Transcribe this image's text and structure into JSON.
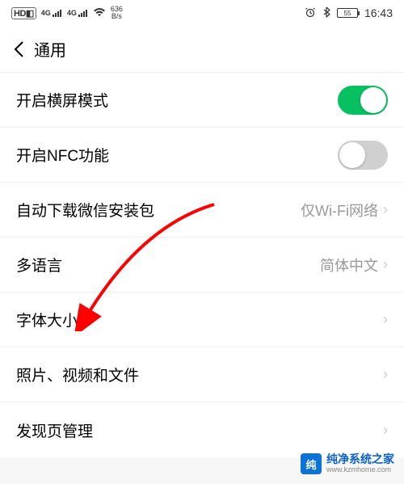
{
  "statusBar": {
    "hd": "HD",
    "sim1_net": "4G",
    "sim2_net": "4G",
    "netSpeed_top": "636",
    "netSpeed_bottom": "B/s",
    "battery": "55",
    "time": "16:43"
  },
  "nav": {
    "title": "通用"
  },
  "rows": {
    "landscape": {
      "label": "开启横屏模式"
    },
    "nfc": {
      "label": "开启NFC功能"
    },
    "autoDownload": {
      "label": "自动下载微信安装包",
      "value": "仅Wi-Fi网络"
    },
    "multiLang": {
      "label": "多语言",
      "value": "简体中文"
    },
    "fontSize": {
      "label": "字体大小"
    },
    "media": {
      "label": "照片、视频和文件"
    },
    "discover": {
      "label": "发现页管理"
    }
  },
  "watermark": {
    "name": "纯净系统之家",
    "url": "www.kzmhome.com"
  },
  "colors": {
    "accent": "#07c160",
    "arrow": "#ff0000"
  }
}
